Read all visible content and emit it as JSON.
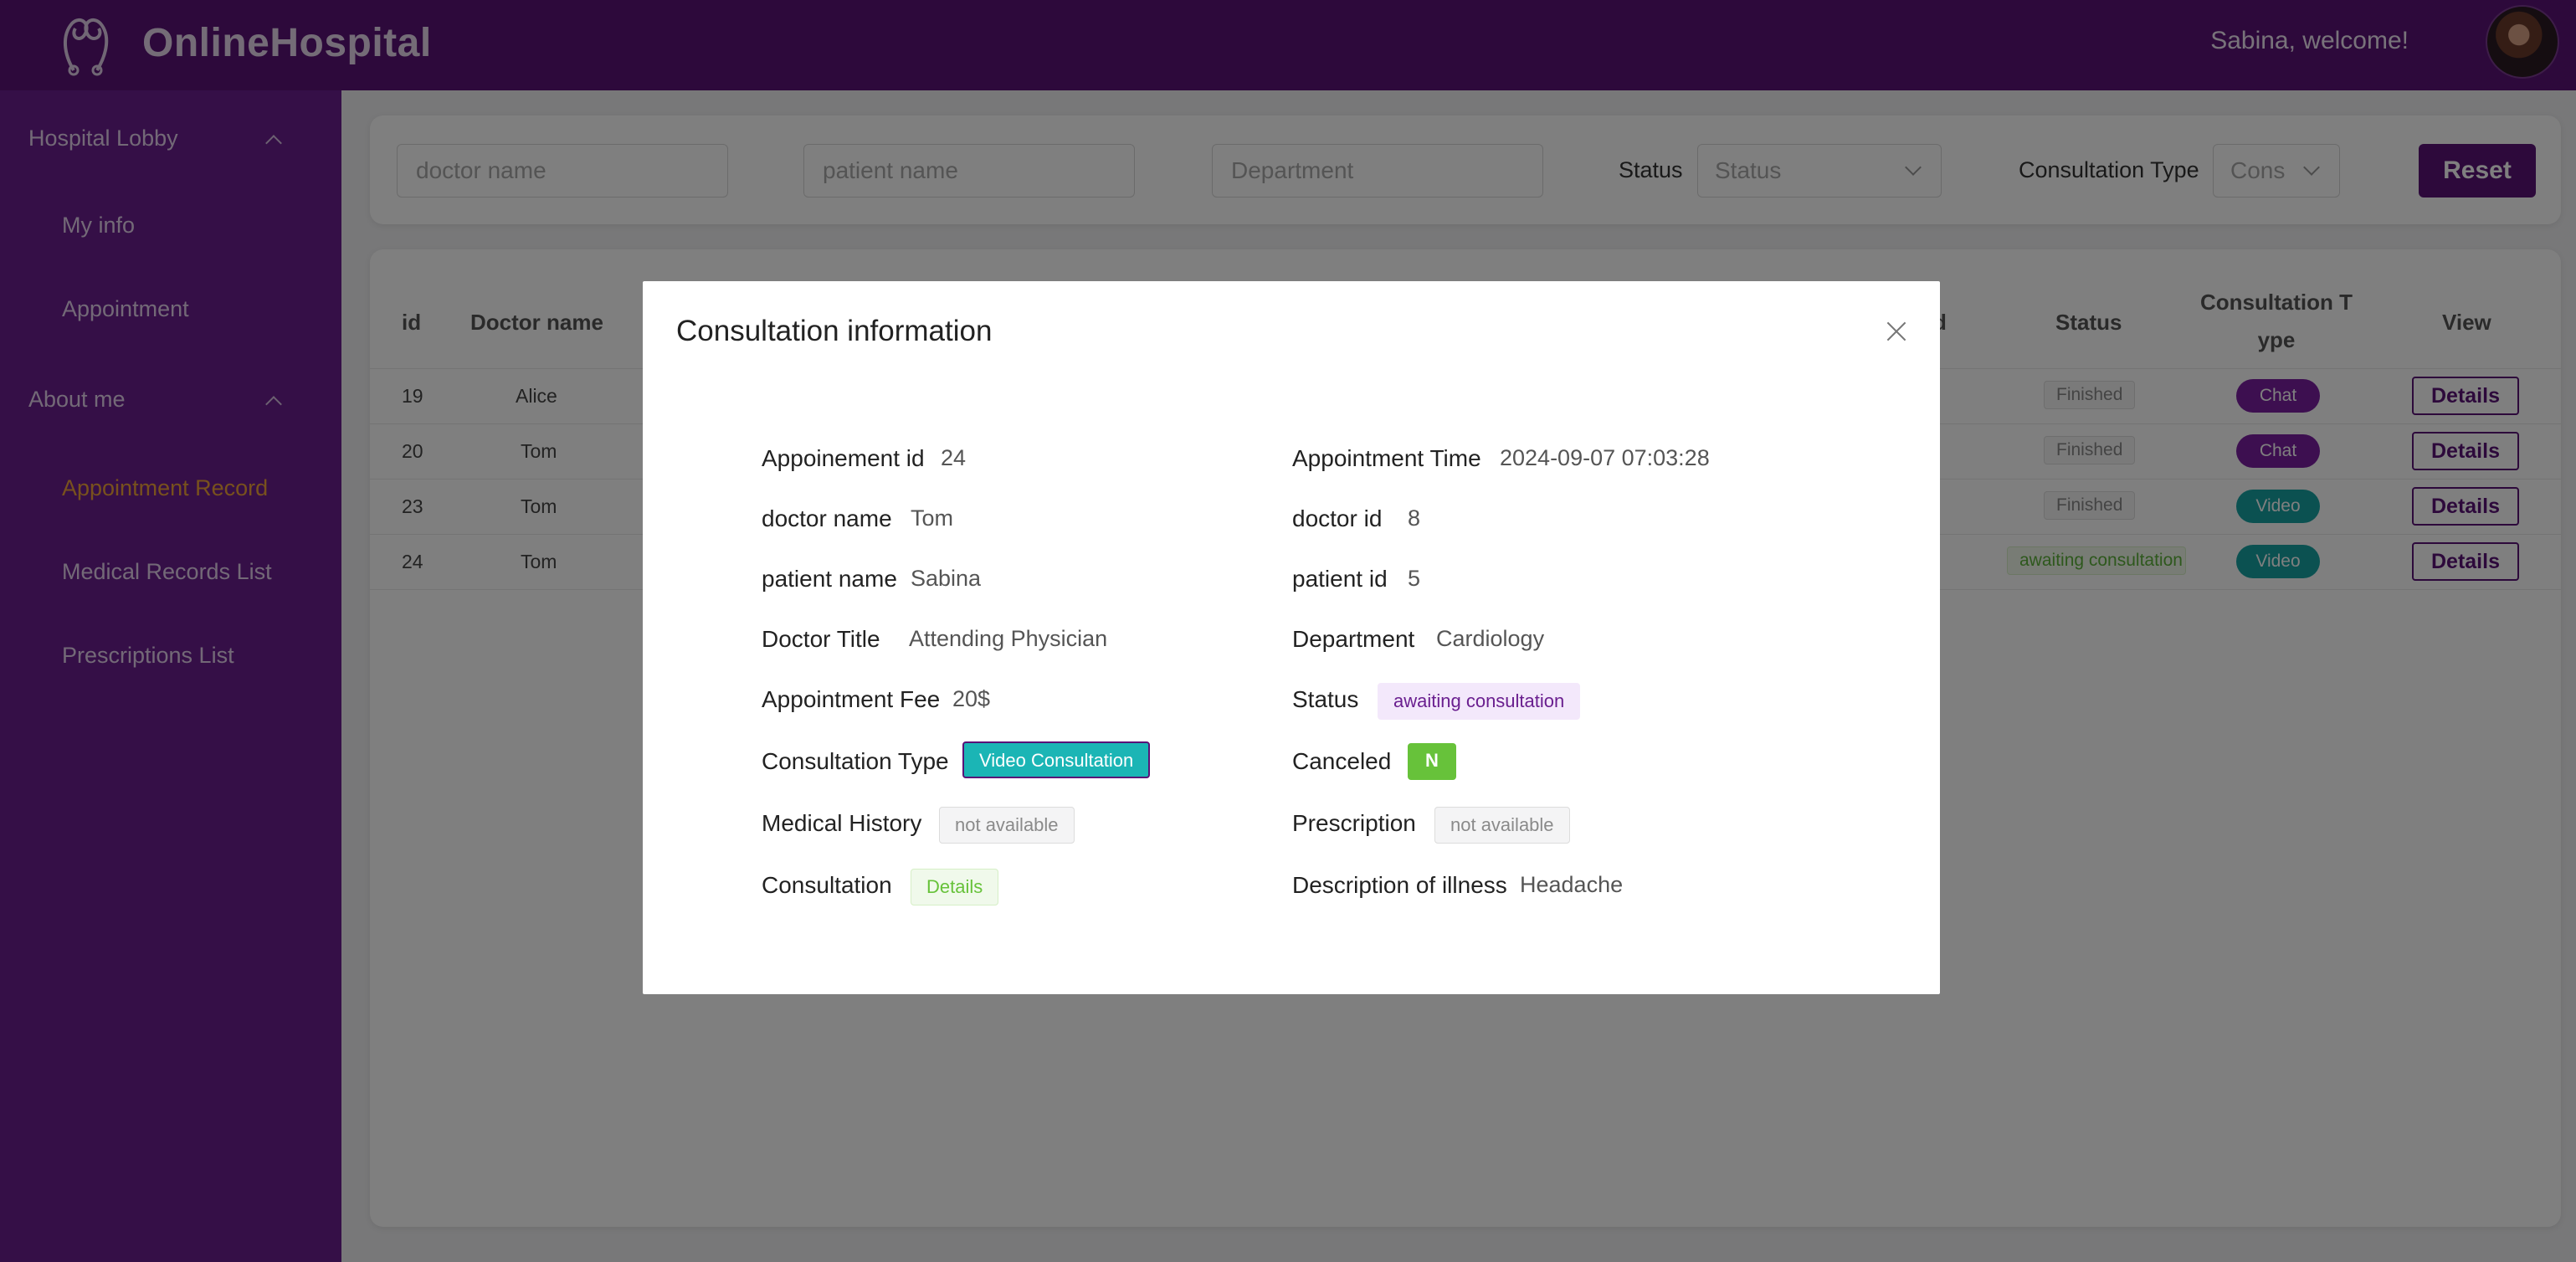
{
  "header": {
    "brand": "OnlineHospital",
    "welcome": "Sabina, welcome!"
  },
  "sidebar": {
    "group_lobby": "Hospital Lobby",
    "item_my_info": "My info",
    "item_appointment": "Appointment",
    "group_about": "About me",
    "item_appointment_record": "Appointment Record",
    "item_medical_records": "Medical Records List",
    "item_prescriptions": "Prescriptions List"
  },
  "filters": {
    "doctor_placeholder": "doctor name",
    "patient_placeholder": "patient name",
    "department_placeholder": "Department",
    "status_label": "Status",
    "status_placeholder": "Status",
    "consultation_type_label": "Consultation Type",
    "consultation_type_placeholder": "Cons",
    "reset": "Reset"
  },
  "table": {
    "headers": {
      "id": "id",
      "doctor_name": "Doctor name",
      "partial": "d",
      "status": "Status",
      "consultation_type_1": "Consultation T",
      "consultation_type_2": "ype",
      "view": "View"
    },
    "rows": [
      {
        "id": "19",
        "doctor": "Alice",
        "status": "Finished",
        "type": "Chat",
        "view": "Details"
      },
      {
        "id": "20",
        "doctor": "Tom",
        "status": "Finished",
        "type": "Chat",
        "view": "Details"
      },
      {
        "id": "23",
        "doctor": "Tom",
        "status": "Finished",
        "type": "Video",
        "view": "Details"
      },
      {
        "id": "24",
        "doctor": "Tom",
        "status": "awaiting consultation",
        "type": "Video",
        "view": "Details"
      }
    ]
  },
  "modal": {
    "title": "Consultation information",
    "appointment_id_label": "Appoinement id",
    "appointment_id": "24",
    "appointment_time_label": "Appointment Time",
    "appointment_time": "2024-09-07 07:03:28",
    "doctor_name_label": "doctor name",
    "doctor_name": "Tom",
    "doctor_id_label": "doctor id",
    "doctor_id": "8",
    "patient_name_label": "patient name",
    "patient_name": "Sabina",
    "patient_id_label": "patient id",
    "patient_id": "5",
    "doctor_title_label": "Doctor Title",
    "doctor_title": "Attending Physician",
    "department_label": "Department",
    "department": "Cardiology",
    "fee_label": "Appointment Fee",
    "fee": "20$",
    "status_label": "Status",
    "status": "awaiting consultation",
    "consultation_type_label": "Consultation Type",
    "consultation_type": "Video Consultation",
    "canceled_label": "Canceled",
    "canceled": "N",
    "medical_history_label": "Medical History",
    "medical_history": "not available",
    "prescription_label": "Prescription",
    "prescription": "not available",
    "consultation_label": "Consultation",
    "consultation": "Details",
    "description_label": "Description of illness",
    "description": "Headache"
  },
  "colors": {
    "header_bg": "#5a1277",
    "sidebar_bg": "#6a1f8f",
    "active_item": "#f0a23a",
    "chat_pill": "#7a1fa0",
    "video_pill": "#17a3a3"
  }
}
